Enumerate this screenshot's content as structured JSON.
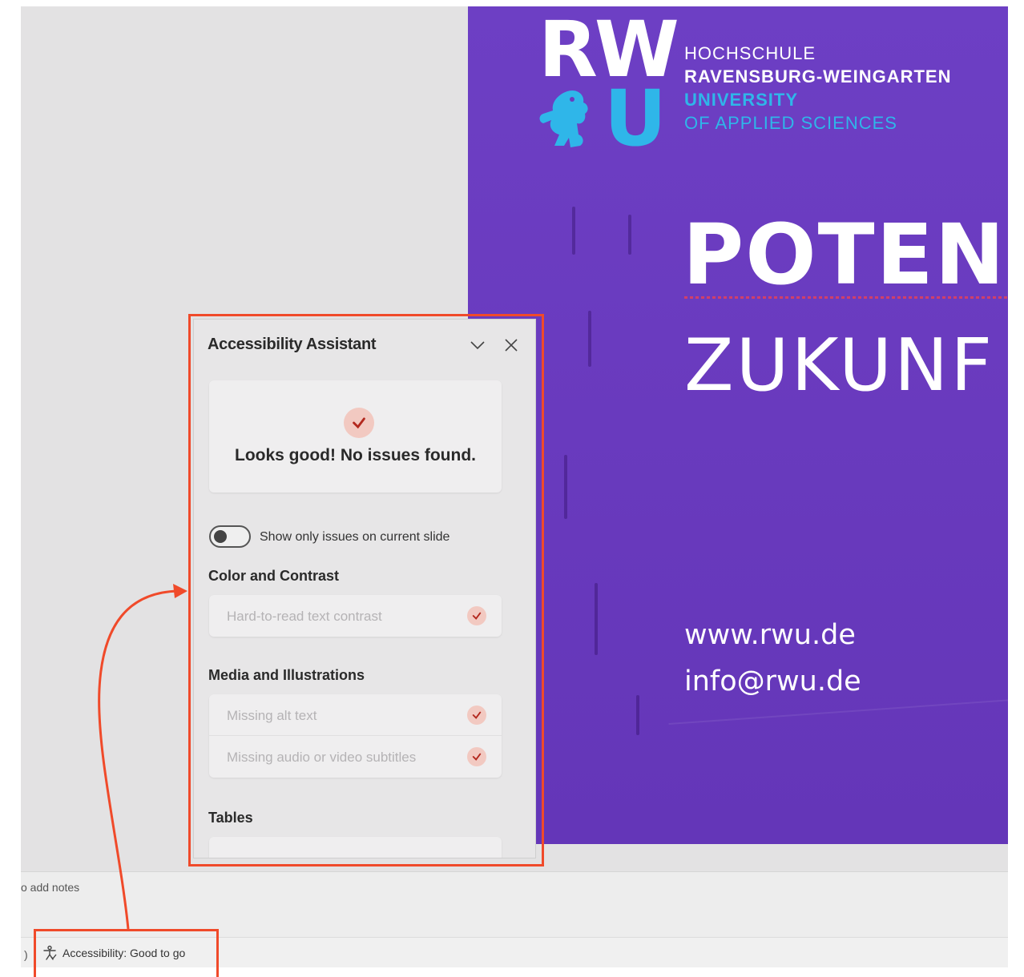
{
  "slide": {
    "logo_rw": "RW",
    "logo_u": "U",
    "institution_lines": [
      "HOCHSCHULE",
      "RAVENSBURG-WEINGARTEN",
      "UNIVERSITY",
      "OF APPLIED SCIENCES"
    ],
    "title_main": "POTENZ",
    "title_sub": "ZUKUNF",
    "website": "www.rwu.de",
    "email": "info@rwu.de"
  },
  "notes": {
    "placeholder": "o add notes"
  },
  "status_bar": {
    "separator": ")",
    "accessibility_label": "Accessibility: Good to go",
    "icon": "accessibility-icon"
  },
  "panel": {
    "title": "Accessibility Assistant",
    "collapse_icon": "chevron-down-icon",
    "close_icon": "close-icon",
    "summary_message": "Looks good! No issues found.",
    "toggle_label": "Show only issues on current slide",
    "toggle_on": false,
    "sections": [
      {
        "heading": "Color and Contrast",
        "items": [
          "Hard-to-read text contrast"
        ]
      },
      {
        "heading": "Media and Illustrations",
        "items": [
          "Missing alt text",
          "Missing audio or video subtitles"
        ]
      },
      {
        "heading": "Tables",
        "items": []
      }
    ]
  },
  "colors": {
    "slide_purple": "#6a3bbf",
    "rwu_cyan": "#2fb6e9",
    "annotation_red": "#f04a2a",
    "check_bg": "#f2c9c1",
    "check_mark": "#b3281e"
  }
}
